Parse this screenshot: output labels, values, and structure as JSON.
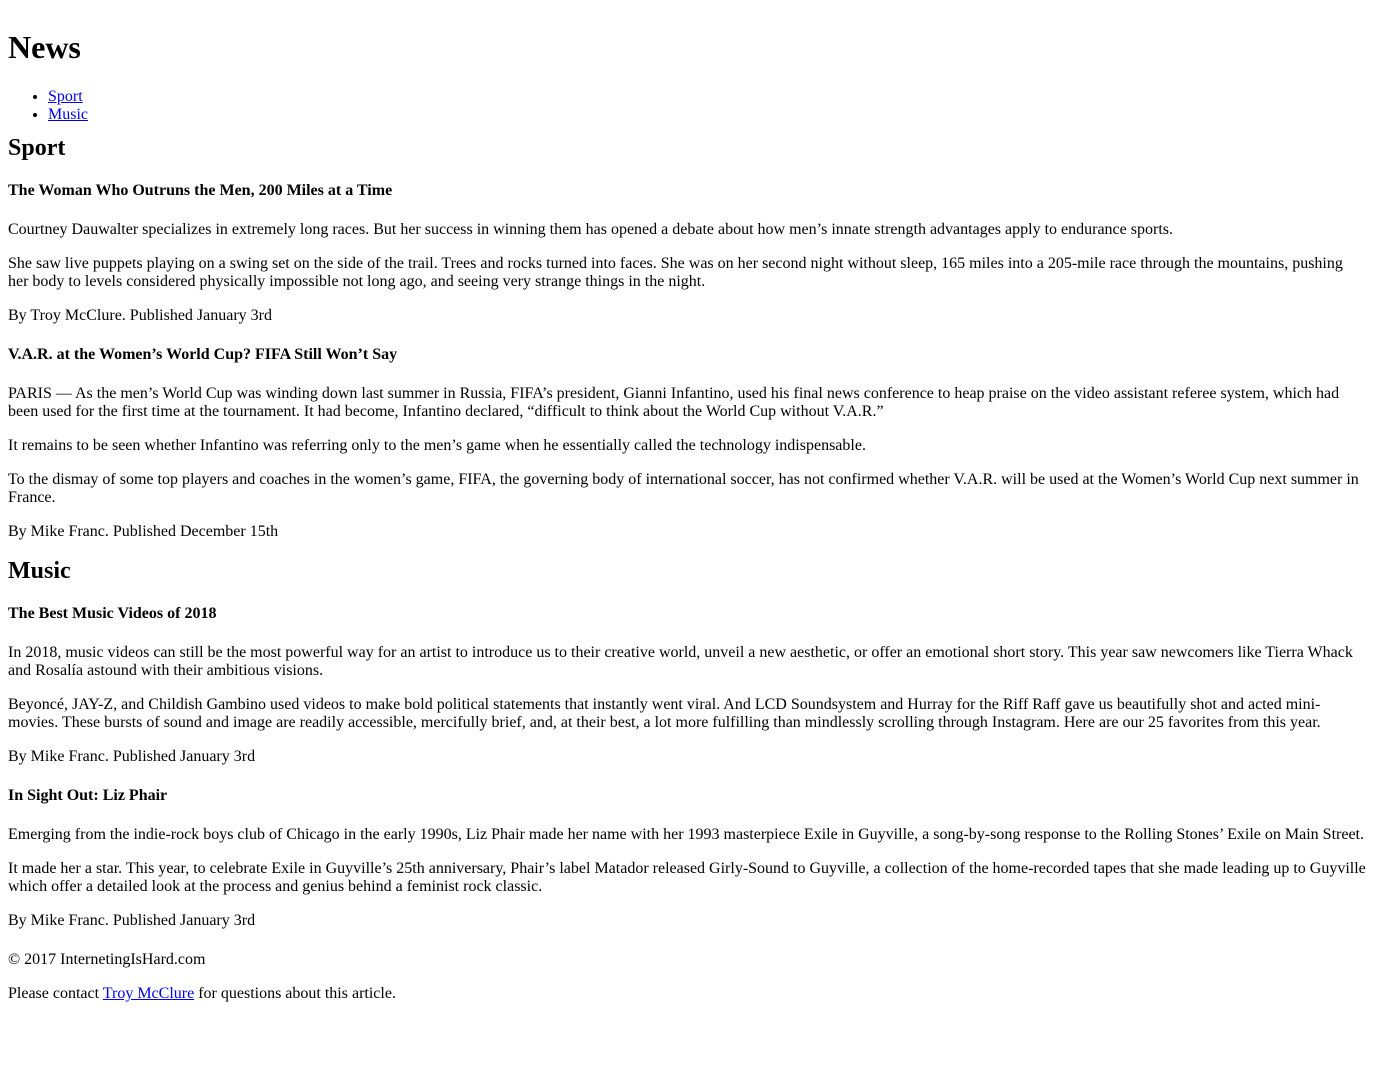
{
  "page": {
    "title": "News"
  },
  "nav": {
    "items": [
      {
        "label": "Sport"
      },
      {
        "label": "Music"
      }
    ]
  },
  "sections": {
    "sport": {
      "heading": "Sport",
      "articles": [
        {
          "title": "The Woman Who Outruns the Men, 200 Miles at a Time",
          "paragraphs": [
            "Courtney Dauwalter specializes in extremely long races. But her success in winning them has opened a debate about how men’s innate strength advantages apply to endurance sports.",
            "She saw live puppets playing on a swing set on the side of the trail. Trees and rocks turned into faces. She was on her second night without sleep, 165 miles into a 205-mile race through the mountains, pushing her body to levels considered physically impossible not long ago, and seeing very strange things in the night."
          ],
          "byline": "By Troy McClure. Published January 3rd"
        },
        {
          "title": "V.A.R. at the Women’s World Cup? FIFA Still Won’t Say",
          "paragraphs": [
            "PARIS — As the men’s World Cup was winding down last summer in Russia, FIFA’s president, Gianni Infantino, used his final news conference to heap praise on the video assistant referee system, which had been used for the first time at the tournament. It had become, Infantino declared, “difficult to think about the World Cup without V.A.R.”",
            "It remains to be seen whether Infantino was referring only to the men’s game when he essentially called the technology indispensable.",
            "To the dismay of some top players and coaches in the women’s game, FIFA, the governing body of international soccer, has not confirmed whether V.A.R. will be used at the Women’s World Cup next summer in France."
          ],
          "byline": "By Mike Franc. Published December 15th"
        }
      ]
    },
    "music": {
      "heading": "Music",
      "articles": [
        {
          "title": "The Best Music Videos of 2018",
          "paragraphs": [
            "In 2018, music videos can still be the most powerful way for an artist to introduce us to their creative world, unveil a new aesthetic, or offer an emotional short story. This year saw newcomers like Tierra Whack and Rosalía astound with their ambitious visions.",
            "Beyoncé, JAY-Z, and Childish Gambino used videos to make bold political statements that instantly went viral. And LCD Soundsystem and Hurray for the Riff Raff gave us beautifully shot and acted mini-movies. These bursts of sound and image are readily accessible, mercifully brief, and, at their best, a lot more fulfilling than mindlessly scrolling through Instagram. Here are our 25 favorites from this year."
          ],
          "byline": "By Mike Franc. Published January 3rd"
        },
        {
          "title": "In Sight Out: Liz Phair",
          "paragraphs": [
            "Emerging from the indie-rock boys club of Chicago in the early 1990s, Liz Phair made her name with her 1993 masterpiece Exile in Guyville, a song-by-song response to the Rolling Stones’ Exile on Main Street.",
            "It made her a star. This year, to celebrate Exile in Guyville’s 25th anniversary, Phair’s label Matador released Girly-Sound to Guyville, a collection of the home-recorded tapes that she made leading up to Guyville which offer a detailed look at the process and genius behind a feminist rock classic."
          ],
          "byline": "By Mike Franc. Published January 3rd"
        }
      ]
    }
  },
  "footer": {
    "copyright": "© 2017 InternetingIsHard.com",
    "contact_prefix": "Please contact ",
    "contact_link": "Troy McClure",
    "contact_suffix": " for questions about this article."
  },
  "colors": {
    "link": "#0000ee",
    "text": "#000000",
    "background": "#ffffff"
  }
}
